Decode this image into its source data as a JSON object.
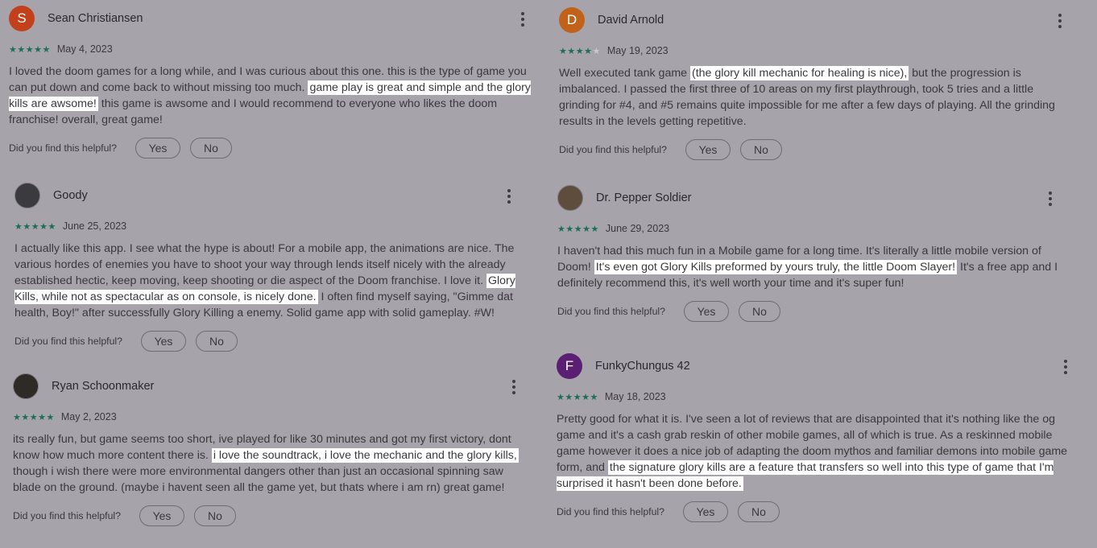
{
  "helpful_prompt": "Did you find this helpful?",
  "yes_label": "Yes",
  "no_label": "No",
  "reviews": [
    {
      "author": "Sean Christiansen",
      "avatar_letter": "S",
      "avatar_color": "#c2401c",
      "rating": 5,
      "date": "May 4, 2023",
      "text_parts": [
        {
          "t": "I loved the doom games for a long while, and I was curious about this one. this is the type of game you can put down and come back to without missing too much. ",
          "hl": false
        },
        {
          "t": "game play is great and simple and the glory kills are awsome!",
          "hl": true
        },
        {
          "t": " this game is awsome and I would recommend to everyone who likes the doom franchise! overall, great game!",
          "hl": false
        }
      ]
    },
    {
      "author": "Goody",
      "avatar_letter": "",
      "avatar_color": "#3b3a3f",
      "rating": 5,
      "date": "June 25, 2023",
      "text_parts": [
        {
          "t": "I actually like this app. I see what the hype is about! For a mobile app, the animations are nice. The various hordes of enemies you have to shoot your way through lends itself nicely with the already established hectic, keep moving, keep shooting or die aspect of the Doom franchise. I love it. ",
          "hl": false
        },
        {
          "t": "Glory Kills, while not as spectacular as on console, is nicely done.",
          "hl": true
        },
        {
          "t": " I often find myself saying, \"Gimme dat health, Boy!\" after successfully Glory Killing a enemy. Solid game app with solid gameplay. #W!",
          "hl": false
        }
      ]
    },
    {
      "author": "Ryan Schoonmaker",
      "avatar_letter": "",
      "avatar_color": "#2e2a26",
      "rating": 5,
      "date": "May 2, 2023",
      "text_parts": [
        {
          "t": "its really fun, but game seems too short, ive played for like 30 minutes and got my first victory, dont know how much more content there is. ",
          "hl": false
        },
        {
          "t": "i love the soundtrack, i love the mechanic and the glory kills,",
          "hl": true
        },
        {
          "t": " though i wish there were more environmental dangers other than just an occasional spinning saw blade on the ground. (maybe i havent seen all the game yet, but thats where i am rn) great game!",
          "hl": false
        }
      ]
    },
    {
      "author": "David Arnold",
      "avatar_letter": "D",
      "avatar_color": "#c2621a",
      "rating": 4,
      "date": "May 19, 2023",
      "text_parts": [
        {
          "t": "Well executed tank game ",
          "hl": false
        },
        {
          "t": "(the glory kill mechanic for healing is nice),",
          "hl": true
        },
        {
          "t": " but the progression is imbalanced. I passed the first three of 10 areas on my first playthrough, took 5 tries and a little grinding for #4, and #5 remains quite impossible for me after a few days of playing. All the grinding results in the levels getting repetitive.",
          "hl": false
        }
      ]
    },
    {
      "author": "Dr. Pepper Soldier",
      "avatar_letter": "",
      "avatar_color": "#5e4c3c",
      "rating": 5,
      "date": "June 29, 2023",
      "text_parts": [
        {
          "t": "I haven't had this much fun in a Mobile game for a long time. It's literally a little mobile version of Doom! ",
          "hl": false
        },
        {
          "t": "It's even got Glory Kills preformed by yours truly, the little Doom Slayer!",
          "hl": true
        },
        {
          "t": " It's a free app and I definitely recommend this, it's well worth your time and it's super fun!",
          "hl": false
        }
      ]
    },
    {
      "author": "FunkyChungus 42",
      "avatar_letter": "F",
      "avatar_color": "#5a1f73",
      "rating": 5,
      "date": "May 18, 2023",
      "text_parts": [
        {
          "t": "Pretty good for what it is. I've seen a lot of reviews that are disappointed that it's nothing like the og game and it's a cash grab reskin of other mobile games, all of which is true. As a reskinned mobile game however it does a nice job of adapting the doom mythos and familiar demons into mobile game form, and ",
          "hl": false
        },
        {
          "t": "the signature glory kills are a feature that transfers so well into this type of game that I'm surprised it hasn't been done before.",
          "hl": true
        }
      ]
    }
  ]
}
